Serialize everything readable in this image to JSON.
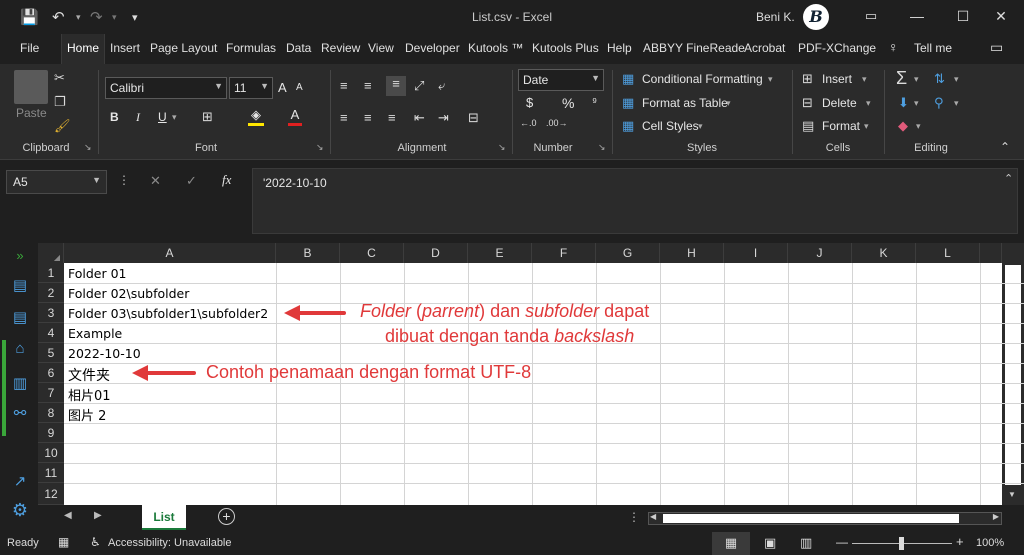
{
  "window": {
    "title": "List.csv  -  Excel",
    "user": "Beni K.",
    "avatar_letter": "B",
    "controls": [
      "🔍",
      "▭",
      "—",
      "☐",
      "✕"
    ]
  },
  "qat": {
    "save": "💾",
    "undo": "↶",
    "redo": "↷",
    "customize": "▾"
  },
  "tabs": [
    "File",
    "Home",
    "Insert",
    "Page Layout",
    "Formulas",
    "Data",
    "Review",
    "View",
    "Developer",
    "Kutools ™",
    "Kutools Plus",
    "Help",
    "ABBYY FineReade",
    "Acrobat",
    "PDF-XChange",
    "Tell me"
  ],
  "ribbon": {
    "clipboard": {
      "label": "Clipboard",
      "paste": "Paste"
    },
    "font": {
      "label": "Font",
      "name": "Calibri",
      "size": "11",
      "bold": "B",
      "italic": "I",
      "underline": "U",
      "grow": "A",
      "shrink": "A"
    },
    "alignment": {
      "label": "Alignment"
    },
    "number": {
      "label": "Number",
      "format": "Date",
      "currency": "$",
      "percent": "%",
      "comma": "⁹"
    },
    "styles": {
      "label": "Styles",
      "conditional": "Conditional Formatting",
      "table": "Format as Table",
      "cell": "Cell Styles"
    },
    "cells": {
      "label": "Cells",
      "insert": "Insert",
      "delete": "Delete",
      "format": "Format"
    },
    "editing": {
      "label": "Editing"
    }
  },
  "formula": {
    "name_box": "A5",
    "content": "'2022-10-10",
    "fx": "fx"
  },
  "grid": {
    "columns": [
      "A",
      "B",
      "C",
      "D",
      "E",
      "F",
      "G",
      "H",
      "I",
      "J",
      "K",
      "L"
    ],
    "rows": [
      "1",
      "2",
      "3",
      "4",
      "5",
      "6",
      "7",
      "8",
      "9",
      "10",
      "11",
      "12"
    ],
    "cells": [
      "Folder 01",
      "Folder 02\\subfolder",
      "Folder 03\\subfolder1\\subfolder2",
      "Example",
      "2022-10-10",
      "文件夹",
      "相片01",
      "图片 2"
    ]
  },
  "annotations": {
    "note1_l1a": "Folder",
    "note1_l1b": " (",
    "note1_l1c": "parrent",
    "note1_l1d": ") dan ",
    "note1_l1e": "subfolder",
    "note1_l1f": " dapat",
    "note1_l2a": "dibuat dengan tanda ",
    "note1_l2b": "backslash",
    "note2": "Contoh penamaan dengan format UTF-8"
  },
  "sheets": [
    "List"
  ],
  "status": {
    "ready": "Ready",
    "accessibility": "Accessibility: Unavailable",
    "zoom": "100%"
  },
  "colors": {
    "accent_green": "#1a7a3a",
    "annotation_red": "#e0393a"
  }
}
